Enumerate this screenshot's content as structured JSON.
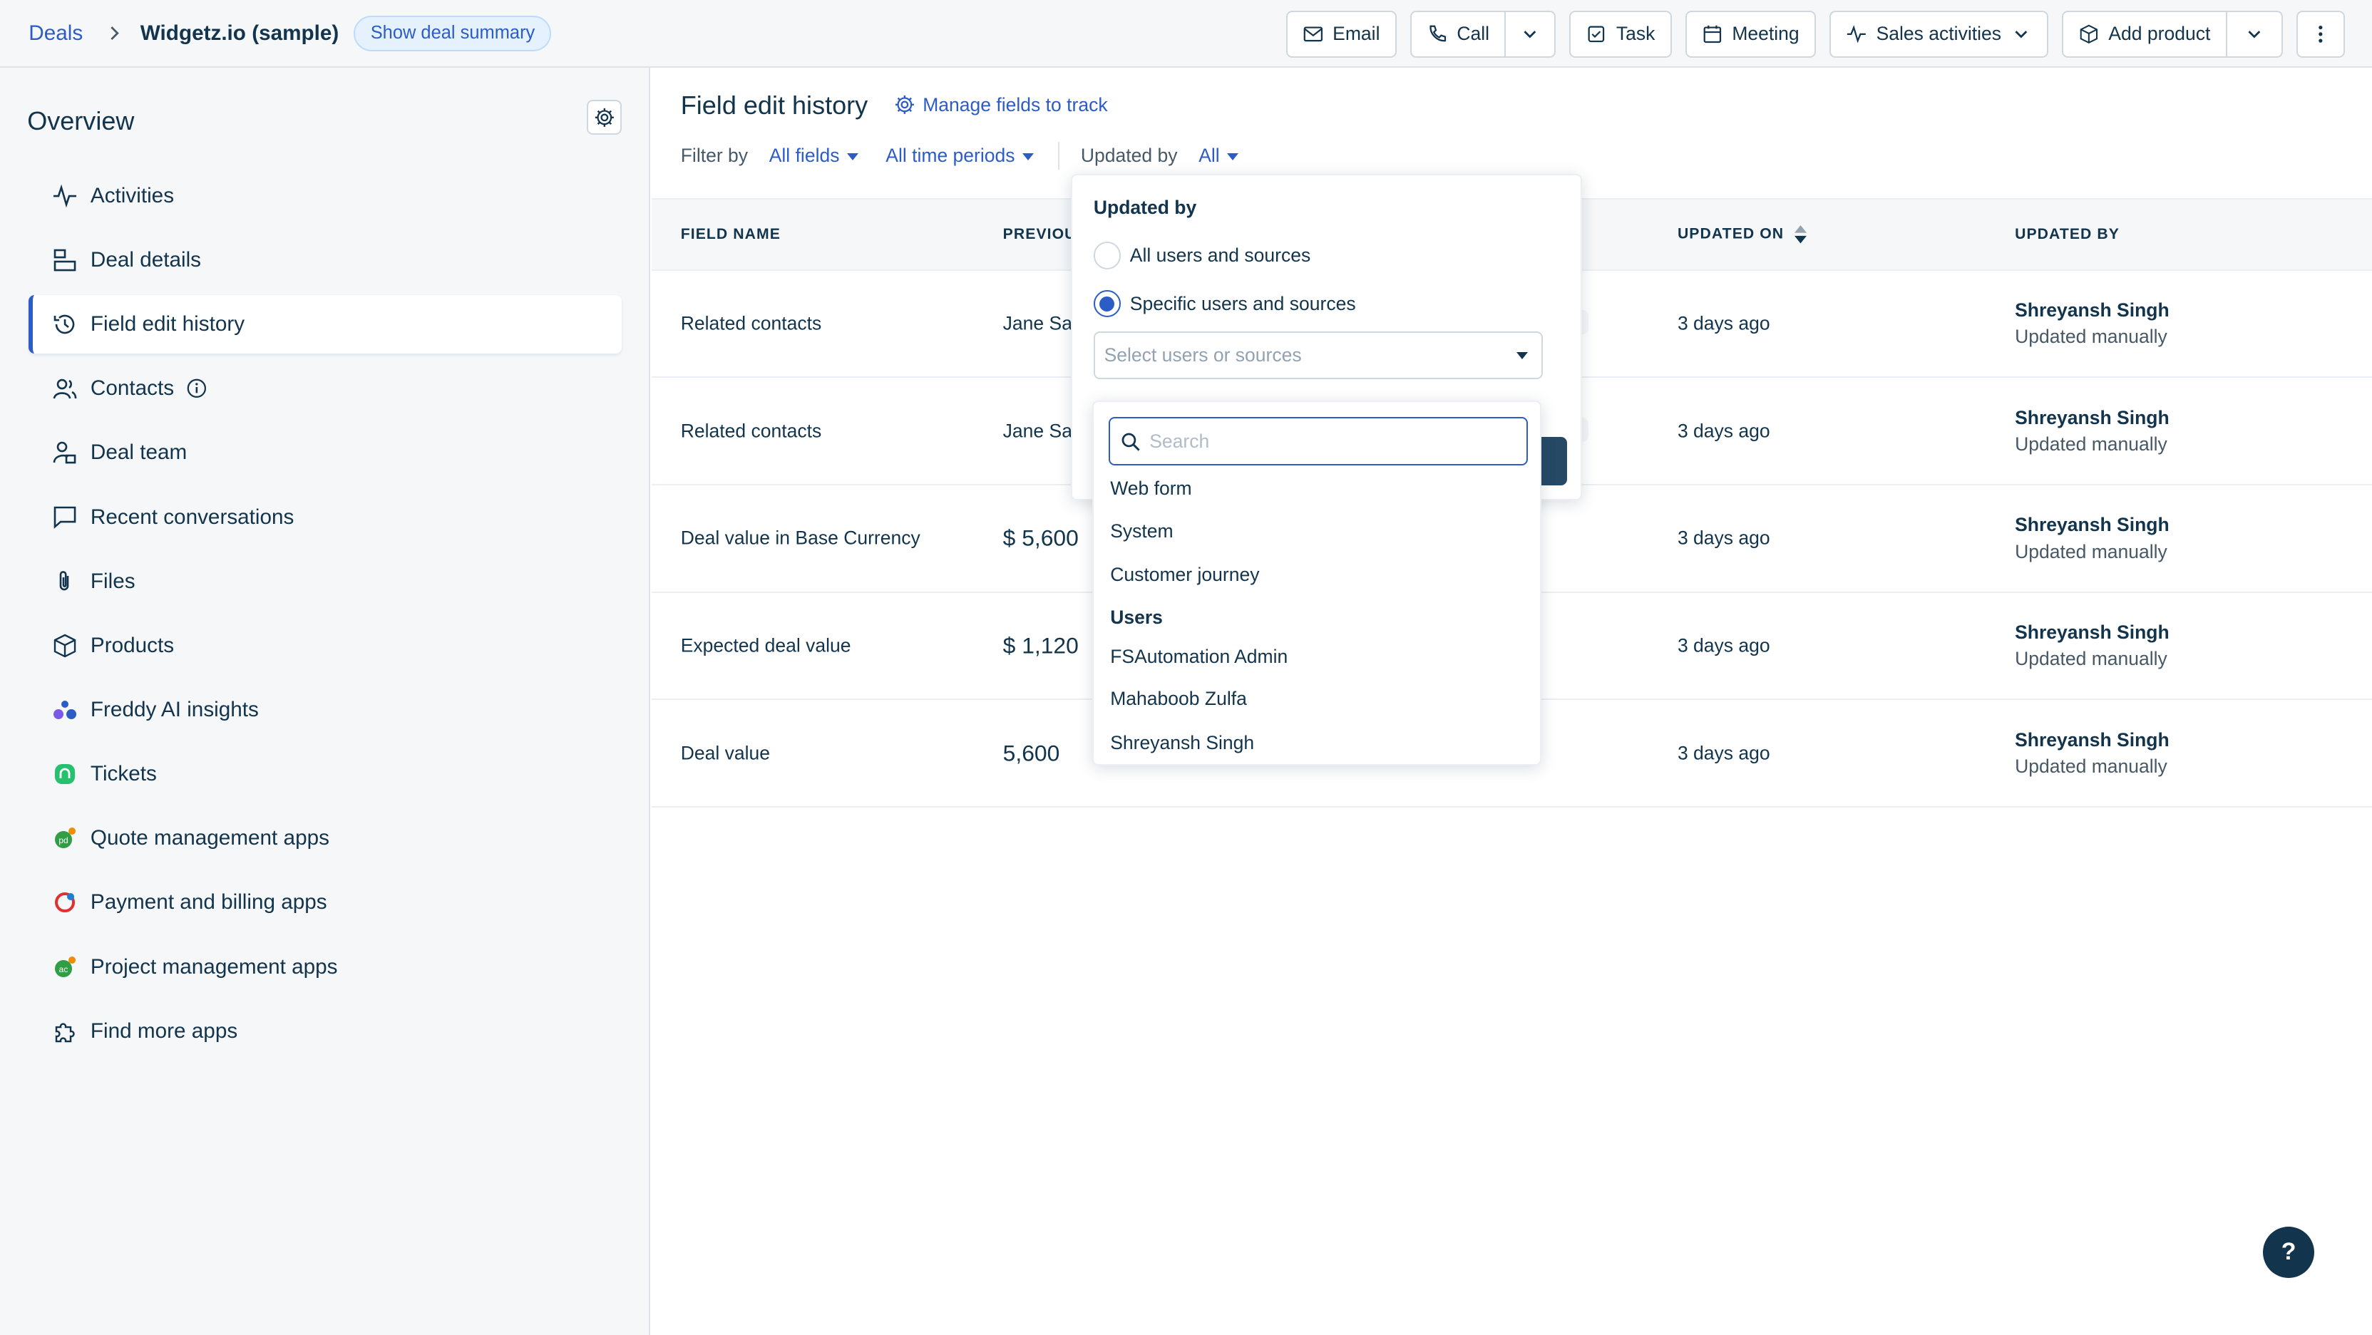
{
  "header": {
    "breadcrumb_root": "Deals",
    "deal_name": "Widgetz.io (sample)",
    "summary_button": "Show deal summary",
    "actions": {
      "email": "Email",
      "call": "Call",
      "task": "Task",
      "meeting": "Meeting",
      "sales_activities": "Sales activities",
      "add_product": "Add product"
    }
  },
  "sidebar": {
    "title": "Overview",
    "items": [
      {
        "label": "Activities",
        "icon": "activity-icon"
      },
      {
        "label": "Deal details",
        "icon": "details-icon"
      },
      {
        "label": "Field edit history",
        "icon": "history-icon",
        "active": true
      },
      {
        "label": "Contacts",
        "icon": "contacts-icon"
      },
      {
        "label": "Deal team",
        "icon": "team-icon"
      },
      {
        "label": "Recent conversations",
        "icon": "chat-icon"
      },
      {
        "label": "Files",
        "icon": "paperclip-icon"
      },
      {
        "label": "Products",
        "icon": "box-icon"
      },
      {
        "label": "Freddy AI insights",
        "icon": "freddy-icon"
      },
      {
        "label": "Tickets",
        "icon": "tickets-icon"
      },
      {
        "label": "Quote management apps",
        "icon": "quote-app-icon"
      },
      {
        "label": "Payment and billing apps",
        "icon": "payment-app-icon"
      },
      {
        "label": "Project management apps",
        "icon": "project-app-icon"
      },
      {
        "label": "Find more apps",
        "icon": "puzzle-icon"
      }
    ]
  },
  "main": {
    "title": "Field edit history",
    "manage_link": "Manage fields to track",
    "filters": {
      "filter_by": "Filter by",
      "fields": "All fields",
      "periods": "All time periods",
      "updated_by_label": "Updated by",
      "updated_by_value": "All"
    },
    "columns": {
      "field_name": "FIELD NAME",
      "previous": "PREVIOU",
      "updated_on": "UPDATED ON",
      "updated_by": "UPDATED BY"
    },
    "rows": [
      {
        "field": "Related contacts",
        "prev": "Jane Sar",
        "updated_on": "3 days ago",
        "by": "Shreyansh Singh",
        "how": "Updated manually"
      },
      {
        "field": "Related contacts",
        "prev": "Jane Sar",
        "updated_on": "3 days ago",
        "by": "Shreyansh Singh",
        "how": "Updated manually"
      },
      {
        "field": "Deal value in Base Currency",
        "prev": "$ 5,600",
        "updated_on": "3 days ago",
        "by": "Shreyansh Singh",
        "how": "Updated manually"
      },
      {
        "field": "Expected deal value",
        "prev": "$ 1,120",
        "updated_on": "3 days ago",
        "by": "Shreyansh Singh",
        "how": "Updated manually"
      },
      {
        "field": "Deal value",
        "prev": "5,600",
        "updated_on": "3 days ago",
        "by": "Shreyansh Singh",
        "how": "Updated manually"
      }
    ]
  },
  "popover": {
    "title": "Updated by",
    "option_all": "All users and sources",
    "option_specific": "Specific users and sources",
    "select_placeholder": "Select users or sources",
    "search_placeholder": "Search",
    "sources": [
      "Web form",
      "System",
      "Customer journey"
    ],
    "users_group": "Users",
    "users": [
      "FSAutomation Admin",
      "Mahaboob Zulfa",
      "Shreyansh Singh"
    ]
  },
  "help_label": "?",
  "colors": {
    "accent": "#2c5cc5",
    "text": "#12344d",
    "sidebar_bg": "#f5f7f9"
  }
}
